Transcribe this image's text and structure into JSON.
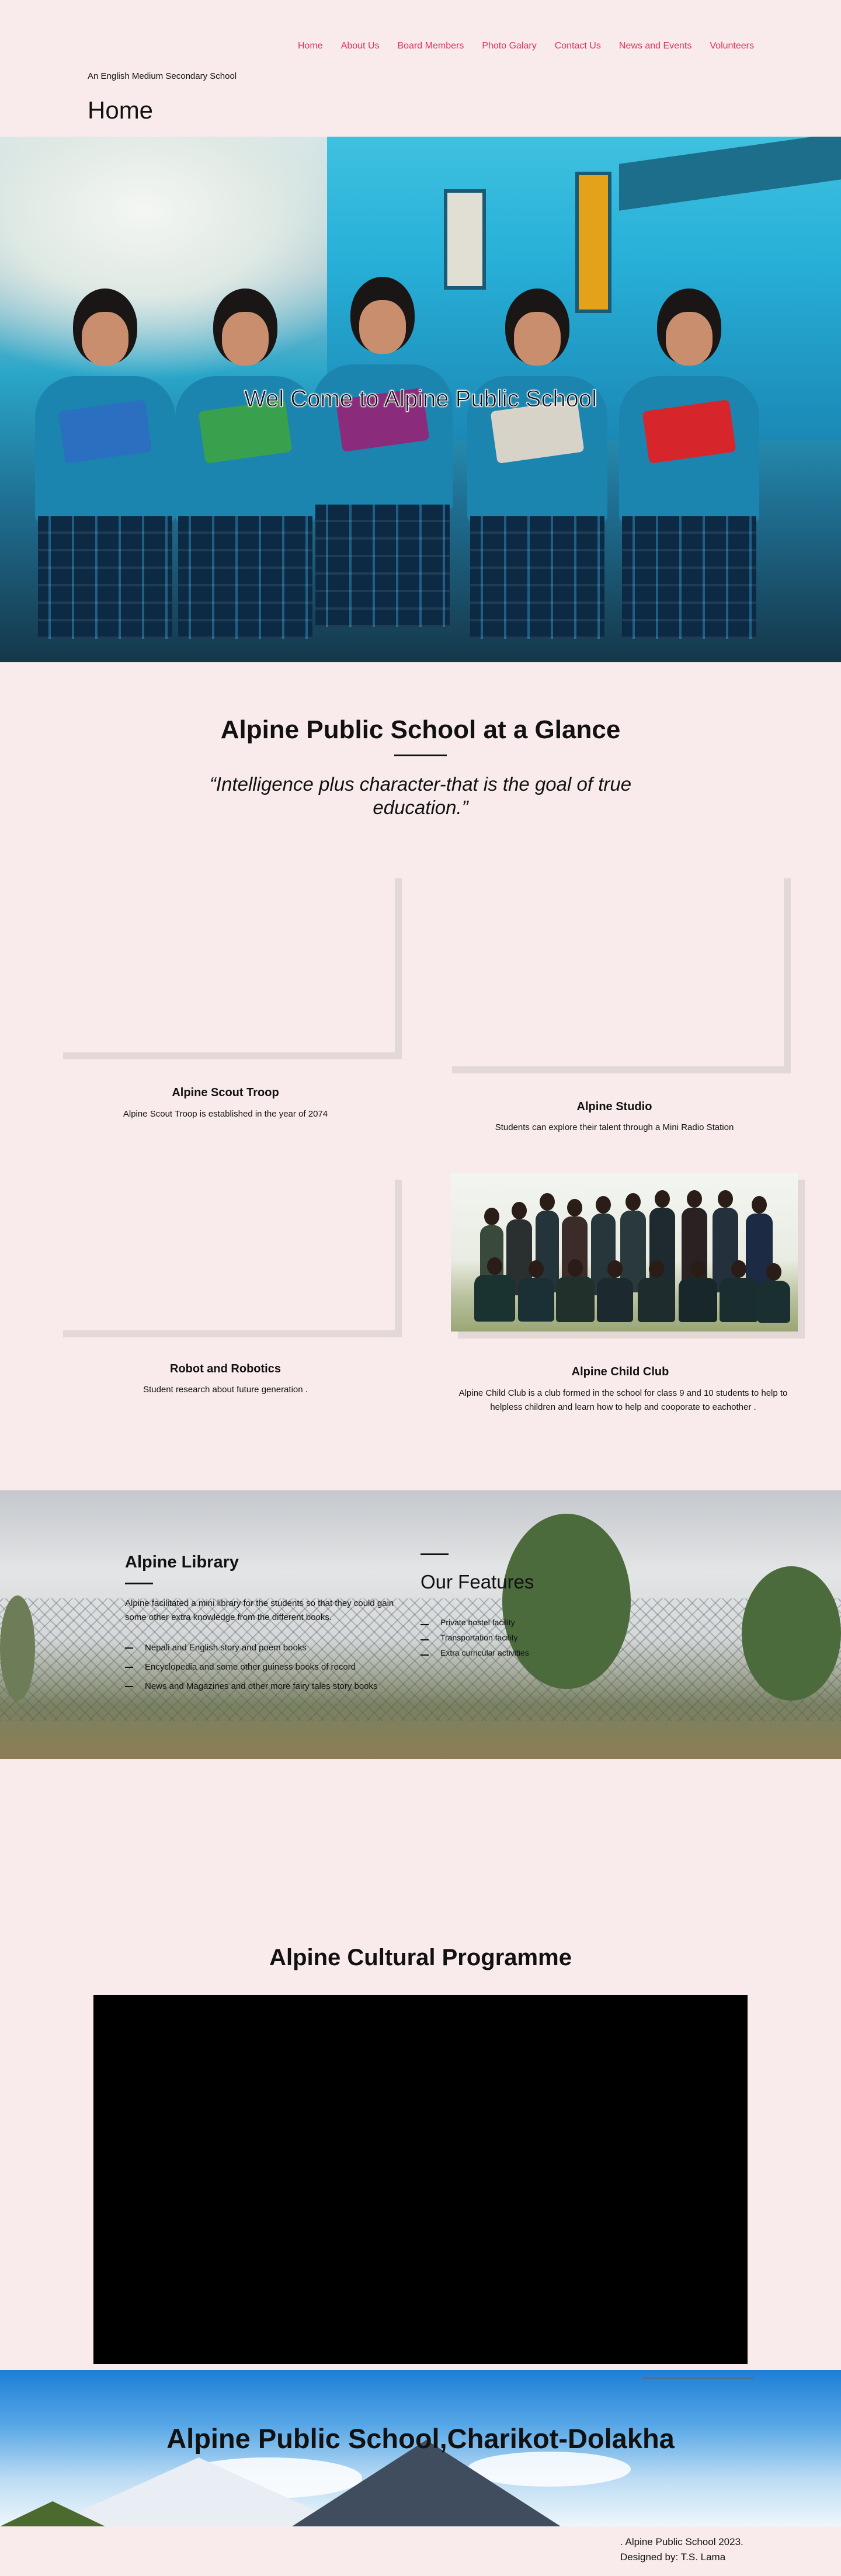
{
  "nav": [
    "Home",
    "About Us",
    "Board Members",
    "Photo Galary",
    "Contact Us",
    "News and Events",
    "Volunteers"
  ],
  "header": {
    "tagline": "An English Medium Secondary School",
    "page_title": "Home"
  },
  "hero": {
    "title": "Wel Come to Alpine Public School"
  },
  "glance": {
    "title": "Alpine Public School at a Glance",
    "quote": "“Intelligence plus character-that is the goal of true education.”"
  },
  "cards": [
    {
      "title": "Alpine Scout Troop",
      "desc": "Alpine Scout Troop is established in the year of 2074"
    },
    {
      "title": "Alpine Studio",
      "desc": "Students can explore their talent through a Mini Radio Station"
    },
    {
      "title": "Robot and Robotics",
      "desc": "Student research about future generation ."
    },
    {
      "title": "Alpine Child Club",
      "desc": "Alpine Child Club is a club formed in the school for class 9 and 10 students to help to helpless children and learn how to help and cooporate to eachother ."
    }
  ],
  "library": {
    "title": "Alpine Library",
    "text": "Alpine facilitated a mini library for the students so that they could gain some other extra knowledge from the different books.",
    "items": [
      "Nepali and English story and poem books",
      "Encyclopedia and some other guiness books of record",
      "News and Magazines and other more fairy tales story books"
    ]
  },
  "features": {
    "title": "Our Features",
    "items": [
      "Private hostel facility",
      "Transportation facility",
      "Extra curricular activities"
    ]
  },
  "culture": {
    "title": "Alpine Cultural Programme"
  },
  "banner": {
    "title": "Alpine Public School,Charikot-Dolakha"
  },
  "footer": {
    "line1": ". Alpine Public School 2023.",
    "line2": "Designed by: T.S. Lama"
  }
}
